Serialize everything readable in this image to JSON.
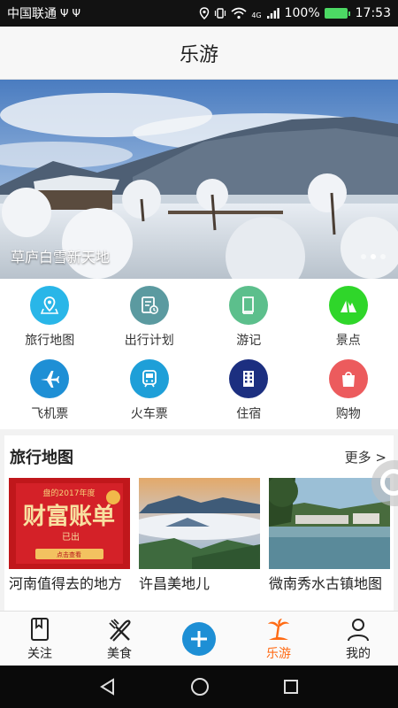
{
  "status_bar": {
    "carrier": "中国联通",
    "usb_icons": "usb-icon",
    "network": "4G",
    "battery": "100%",
    "time": "17:53"
  },
  "header": {
    "title": "乐游"
  },
  "banner": {
    "caption": "草庐白雪新天地",
    "dots_total": 3,
    "active_dot": 1
  },
  "categories": [
    {
      "label": "旅行地图",
      "icon": "map-pin-icon",
      "color": "#29b6e8"
    },
    {
      "label": "出行计划",
      "icon": "calendar-icon",
      "color": "#5b9aa0"
    },
    {
      "label": "游记",
      "icon": "book-icon",
      "color": "#5cbf8c"
    },
    {
      "label": "景点",
      "icon": "mountain-icon",
      "color": "#2fd62a"
    },
    {
      "label": "飞机票",
      "icon": "airplane-icon",
      "color": "#1e8fd5"
    },
    {
      "label": "火车票",
      "icon": "train-icon",
      "color": "#1e9fd8"
    },
    {
      "label": "住宿",
      "icon": "building-icon",
      "color": "#1c2f80"
    },
    {
      "label": "购物",
      "icon": "shopping-bag-icon",
      "color": "#ec5b5d"
    }
  ],
  "section": {
    "title": "旅行地图",
    "more": "更多 >",
    "cards": [
      {
        "title": "河南值得去的地方",
        "poster_top": "盘的2017年度",
        "poster_main": "财富账单",
        "poster_sub": "已出",
        "poster_button": "点击查看"
      },
      {
        "title": "许昌美地儿"
      },
      {
        "title": "微南秀水古镇地图"
      }
    ]
  },
  "tabs": [
    {
      "label": "关注",
      "icon": "bookmark-icon"
    },
    {
      "label": "美食",
      "icon": "fork-knife-icon"
    },
    {
      "label": "",
      "icon": "add-icon"
    },
    {
      "label": "乐游",
      "icon": "palm-tree-icon",
      "active": true
    },
    {
      "label": "我的",
      "icon": "user-icon"
    }
  ],
  "colors": {
    "accent": "#ff6a13",
    "add_button": "#1e8fd5"
  }
}
